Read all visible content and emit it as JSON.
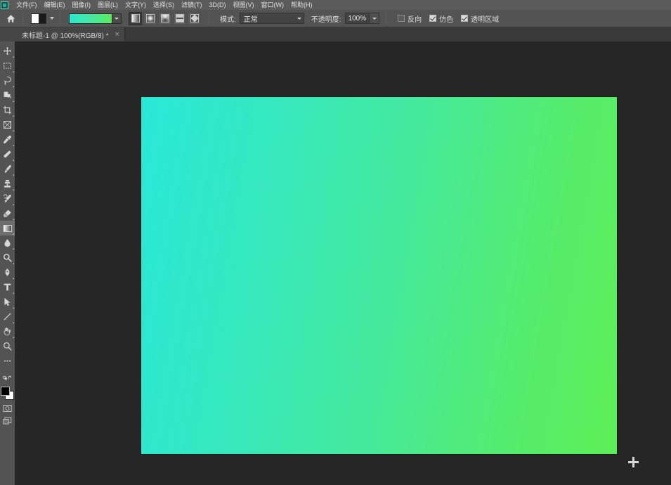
{
  "app": {
    "icon_name": "photoshop-app-icon"
  },
  "menubar": {
    "items": [
      {
        "label": "文件(F)",
        "name": "menu-file"
      },
      {
        "label": "编辑(E)",
        "name": "menu-edit"
      },
      {
        "label": "图像(I)",
        "name": "menu-image"
      },
      {
        "label": "图层(L)",
        "name": "menu-layer"
      },
      {
        "label": "文字(Y)",
        "name": "menu-type"
      },
      {
        "label": "选择(S)",
        "name": "menu-select"
      },
      {
        "label": "滤镜(T)",
        "name": "menu-filter"
      },
      {
        "label": "3D(D)",
        "name": "menu-3d"
      },
      {
        "label": "视图(V)",
        "name": "menu-view"
      },
      {
        "label": "窗口(W)",
        "name": "menu-window"
      },
      {
        "label": "帮助(H)",
        "name": "menu-help"
      }
    ]
  },
  "options_bar": {
    "home_icon": "home-icon",
    "preset_picker_label": "",
    "gradient_swatch": {
      "from": "#2ae8d0",
      "mid": "#42e8a8",
      "to": "#5ced5c"
    },
    "gradient_types": [
      {
        "label": "线性渐变",
        "name": "gradient-type-linear",
        "active": true
      },
      {
        "label": "径向渐变",
        "name": "gradient-type-radial",
        "active": false
      },
      {
        "label": "角度渐变",
        "name": "gradient-type-angle",
        "active": false
      },
      {
        "label": "对称渐变",
        "name": "gradient-type-reflected",
        "active": false
      },
      {
        "label": "菱形渐变",
        "name": "gradient-type-diamond",
        "active": false
      }
    ],
    "mode_label": "模式:",
    "mode_value": "正常",
    "opacity_label": "不透明度:",
    "opacity_value": "100%",
    "checkboxes": [
      {
        "label": "反向",
        "checked": false,
        "name": "checkbox-reverse"
      },
      {
        "label": "仿色",
        "checked": true,
        "name": "checkbox-dither"
      },
      {
        "label": "透明区域",
        "checked": true,
        "name": "checkbox-transparency"
      }
    ]
  },
  "tabbar": {
    "document_title": "未标题-1 @ 100%(RGB/8) *",
    "close_glyph": "×"
  },
  "toolbar": {
    "tools": [
      {
        "name": "tool-move",
        "label": "移动工具",
        "selected": false
      },
      {
        "name": "tool-rectangular-marquee",
        "label": "矩形选框工具",
        "selected": false
      },
      {
        "name": "tool-lasso",
        "label": "套索工具",
        "selected": false
      },
      {
        "name": "tool-quick-selection",
        "label": "快速选择工具",
        "selected": false
      },
      {
        "name": "tool-crop",
        "label": "裁剪工具",
        "selected": false
      },
      {
        "name": "tool-frame",
        "label": "画框工具",
        "selected": false
      },
      {
        "name": "tool-eyedropper",
        "label": "吸管工具",
        "selected": false
      },
      {
        "name": "tool-healing-brush",
        "label": "污点修复画笔工具",
        "selected": false
      },
      {
        "name": "tool-brush",
        "label": "画笔工具",
        "selected": false
      },
      {
        "name": "tool-clone-stamp",
        "label": "仿制图章工具",
        "selected": false
      },
      {
        "name": "tool-history-brush",
        "label": "历史记录画笔工具",
        "selected": false
      },
      {
        "name": "tool-eraser",
        "label": "橡皮擦工具",
        "selected": false
      },
      {
        "name": "tool-gradient",
        "label": "渐变工具",
        "selected": true
      },
      {
        "name": "tool-blur",
        "label": "模糊工具",
        "selected": false
      },
      {
        "name": "tool-dodge",
        "label": "减淡工具",
        "selected": false
      },
      {
        "name": "tool-pen",
        "label": "钢笔工具",
        "selected": false
      },
      {
        "name": "tool-type",
        "label": "横排文字工具",
        "selected": false
      },
      {
        "name": "tool-path-selection",
        "label": "路径选择工具",
        "selected": false
      },
      {
        "name": "tool-line",
        "label": "直线工具",
        "selected": false
      },
      {
        "name": "tool-hand",
        "label": "抓手工具",
        "selected": false
      },
      {
        "name": "tool-zoom",
        "label": "缩放工具",
        "selected": false
      },
      {
        "name": "tool-edit-toolbar",
        "label": "编辑工具栏",
        "selected": false
      }
    ],
    "foreground_color": "#000000",
    "background_color": "#ffffff",
    "quick_mask_label": "以快速蒙版模式编辑",
    "screen_mode_label": "更改屏幕模式"
  },
  "canvas": {
    "gradient_start": "#2ae8d9",
    "gradient_end": "#5dee56",
    "gradient_angle": "100deg",
    "cursor": "crosshair-cursor"
  },
  "workspace": {
    "background_color": "#262626"
  }
}
